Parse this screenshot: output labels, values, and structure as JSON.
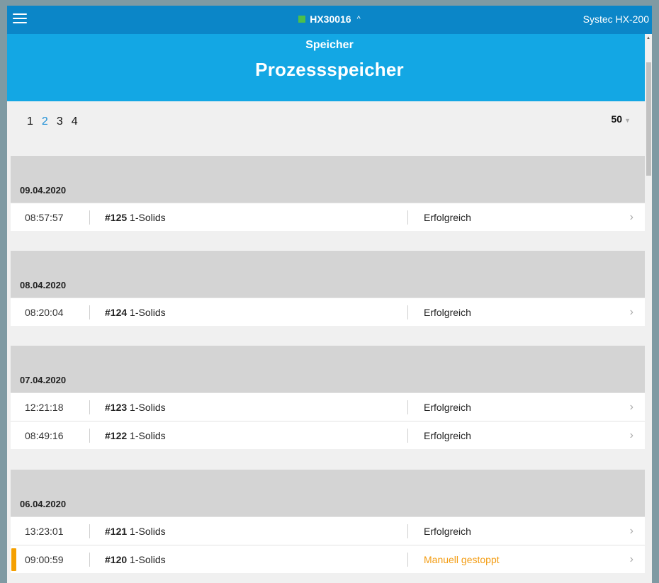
{
  "topbar": {
    "device": "HX30016",
    "device_chevron": "^",
    "app_name": "Systec HX-200",
    "status_color": "#4cbf4a"
  },
  "header": {
    "subtitle": "Speicher",
    "title": "Prozessspeicher"
  },
  "pagination": {
    "pages": [
      "1",
      "2",
      "3",
      "4"
    ],
    "active": "2",
    "page_size": "50"
  },
  "groups": [
    {
      "date": "09.04.2020",
      "rows": [
        {
          "time": "08:57:57",
          "number": "#125",
          "program": "1-Solids",
          "status": "Erfolgreich"
        }
      ]
    },
    {
      "date": "08.04.2020",
      "rows": [
        {
          "time": "08:20:04",
          "number": "#124",
          "program": "1-Solids",
          "status": "Erfolgreich"
        }
      ]
    },
    {
      "date": "07.04.2020",
      "rows": [
        {
          "time": "12:21:18",
          "number": "#123",
          "program": "1-Solids",
          "status": "Erfolgreich"
        },
        {
          "time": "08:49:16",
          "number": "#122",
          "program": "1-Solids",
          "status": "Erfolgreich"
        }
      ]
    },
    {
      "date": "06.04.2020",
      "rows": [
        {
          "time": "13:23:01",
          "number": "#121",
          "program": "1-Solids",
          "status": "Erfolgreich"
        },
        {
          "time": "09:00:59",
          "number": "#120",
          "program": "1-Solids",
          "status": "Manuell gestoppt"
        }
      ]
    }
  ],
  "colors": {
    "topbar": "#0b86c8",
    "header": "#13a7e4",
    "warning": "#f39c12",
    "active_page": "#1d8fd6"
  }
}
